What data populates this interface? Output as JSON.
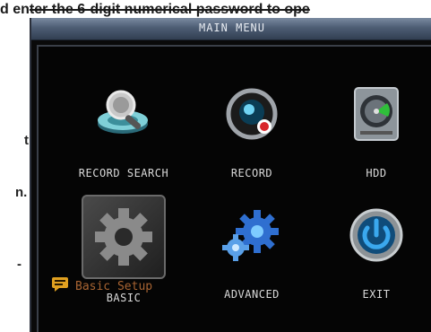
{
  "background_doc": {
    "line1_prefix": "d en",
    "line1_struck": "ter the 6-digit numerical password to ope",
    "line_t": "t",
    "line_n": "n.",
    "line_dash": "-"
  },
  "window": {
    "title": "MAIN MENU"
  },
  "menu": {
    "items": [
      {
        "label": "RECORD SEARCH",
        "icon": "record-search-icon"
      },
      {
        "label": "RECORD",
        "icon": "record-icon"
      },
      {
        "label": "HDD",
        "icon": "hdd-icon"
      },
      {
        "label": "BASIC",
        "icon": "basic-gear-icon",
        "selected": true
      },
      {
        "label": "ADVANCED",
        "icon": "advanced-gears-icon"
      },
      {
        "label": "EXIT",
        "icon": "exit-power-icon"
      }
    ]
  },
  "status": {
    "text": "Basic Setup",
    "icon": "message-icon"
  },
  "colors": {
    "panel_bg": "#050505",
    "title_bar": "#4d5d74",
    "status_text": "#a86432",
    "label_text": "#d9d9d9"
  }
}
